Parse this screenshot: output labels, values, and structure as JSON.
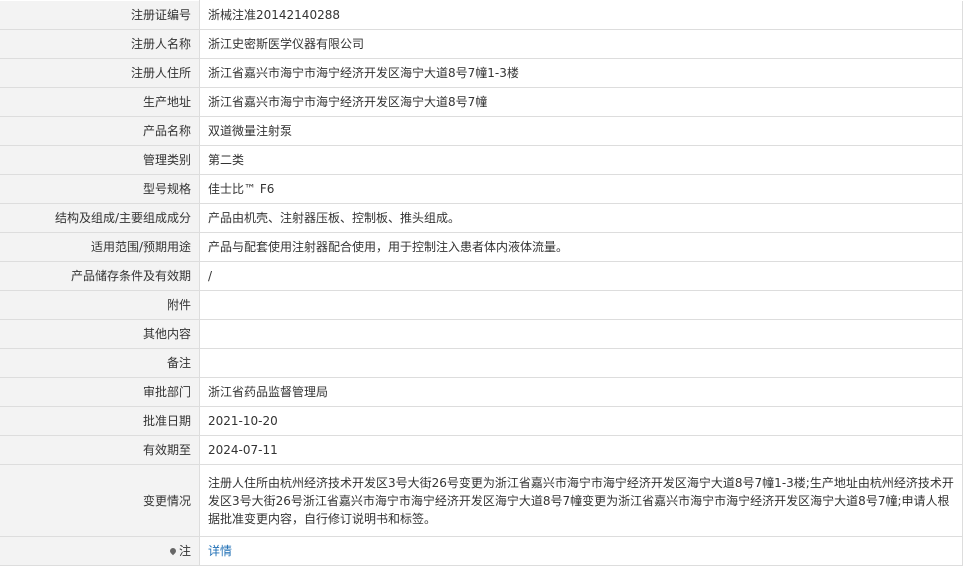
{
  "rows": [
    {
      "label": "注册证编号",
      "value": "浙械注准20142140288"
    },
    {
      "label": "注册人名称",
      "value": "浙江史密斯医学仪器有限公司"
    },
    {
      "label": "注册人住所",
      "value": "浙江省嘉兴市海宁市海宁经济开发区海宁大道8号7幢1-3楼"
    },
    {
      "label": "生产地址",
      "value": "浙江省嘉兴市海宁市海宁经济开发区海宁大道8号7幢"
    },
    {
      "label": "产品名称",
      "value": "双道微量注射泵"
    },
    {
      "label": "管理类别",
      "value": "第二类"
    },
    {
      "label": "型号规格",
      "value": "佳士比™ F6"
    },
    {
      "label": "结构及组成/主要组成成分",
      "value": "产品由机壳、注射器压板、控制板、推头组成。"
    },
    {
      "label": "适用范围/预期用途",
      "value": "产品与配套使用注射器配合使用，用于控制注入患者体内液体流量。"
    },
    {
      "label": "产品储存条件及有效期",
      "value": "/"
    },
    {
      "label": "附件",
      "value": ""
    },
    {
      "label": "其他内容",
      "value": ""
    },
    {
      "label": "备注",
      "value": ""
    },
    {
      "label": "审批部门",
      "value": "浙江省药品监督管理局"
    },
    {
      "label": "批准日期",
      "value": "2021-10-20"
    },
    {
      "label": "有效期至",
      "value": "2024-07-11"
    },
    {
      "label": "变更情况",
      "value": "注册人住所由杭州经济技术开发区3号大街26号变更为浙江省嘉兴市海宁市海宁经济开发区海宁大道8号7幢1-3楼;生产地址由杭州经济技术开发区3号大街26号浙江省嘉兴市海宁市海宁经济开发区海宁大道8号7幢变更为浙江省嘉兴市海宁市海宁经济开发区海宁大道8号7幢;申请人根据批准变更内容，自行修订说明书和标签。"
    }
  ],
  "note": {
    "label": "注",
    "icon": "pin-icon",
    "link_text": "详情"
  }
}
